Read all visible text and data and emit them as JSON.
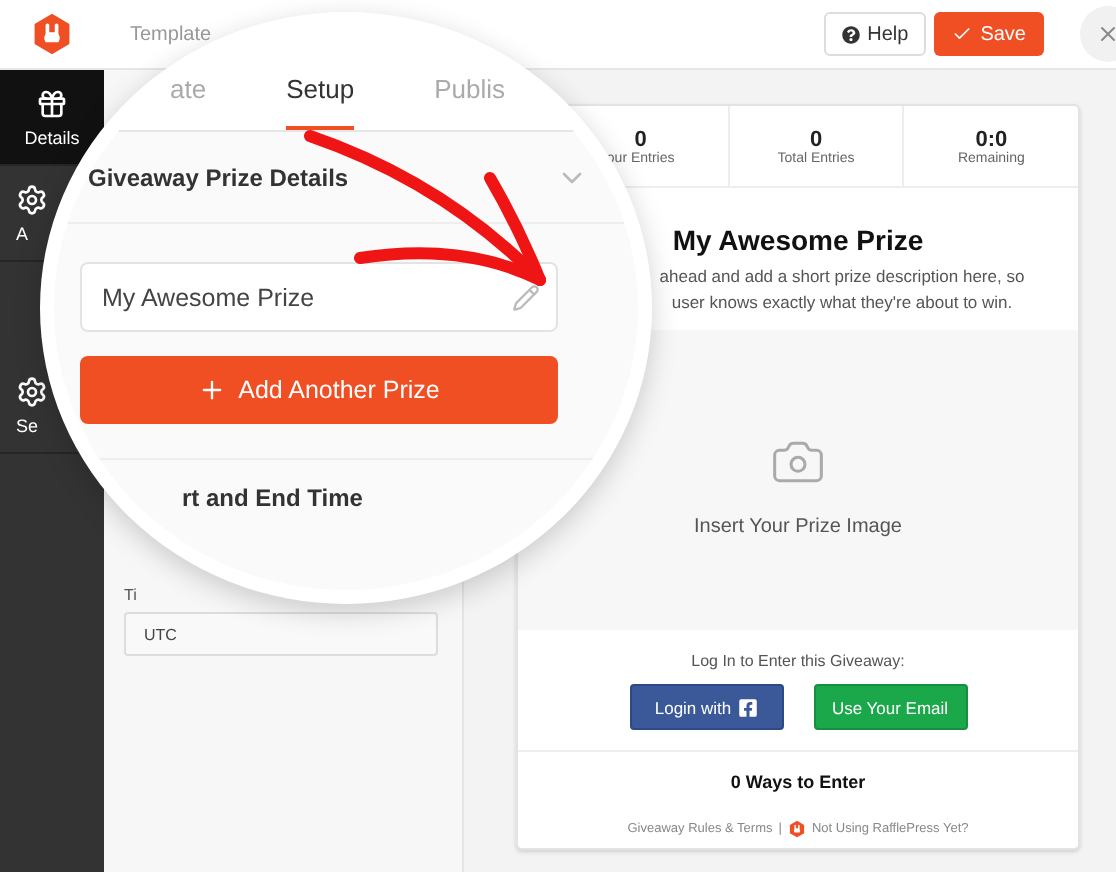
{
  "header": {
    "tabs": [
      {
        "label": "Template",
        "selected": false
      }
    ],
    "help_button": "Help",
    "save_button": "Save"
  },
  "sidebar": {
    "items": [
      {
        "label": "Details",
        "selected": true
      },
      {
        "label": "A",
        "selected": false
      },
      {
        "label": "Se",
        "selected": false
      }
    ]
  },
  "settings": {
    "timezone_label": "Ti",
    "timezone_value": "UTC"
  },
  "magnifier": {
    "tabs": [
      {
        "label": "ate",
        "selected": false
      },
      {
        "label": "Setup",
        "selected": true
      },
      {
        "label": "Publis",
        "selected": false
      }
    ],
    "section_title": "Giveaway Prize Details",
    "prize_name": "My Awesome Prize",
    "add_button": "Add Another Prize",
    "next_section_title": "rt and End Time"
  },
  "preview": {
    "stats": [
      {
        "value": "0",
        "label": "our Entries"
      },
      {
        "value": "0",
        "label": "Total Entries"
      },
      {
        "value": "0:0",
        "label": "Remaining"
      }
    ],
    "title": "My Awesome Prize",
    "description": [
      "ahead and add a short prize description here, so",
      "user knows exactly what they're about to win."
    ],
    "image_placeholder": "Insert Your Prize Image",
    "login_prompt": "Log In to Enter this Giveaway:",
    "login_button": "Login with",
    "email_button": "Use Your Email",
    "ways_to_enter": "0 Ways to Enter",
    "footer_link": "Giveaway Rules & Terms",
    "footer_separator": "|",
    "footer_promo": "Not Using RafflePress Yet?"
  }
}
